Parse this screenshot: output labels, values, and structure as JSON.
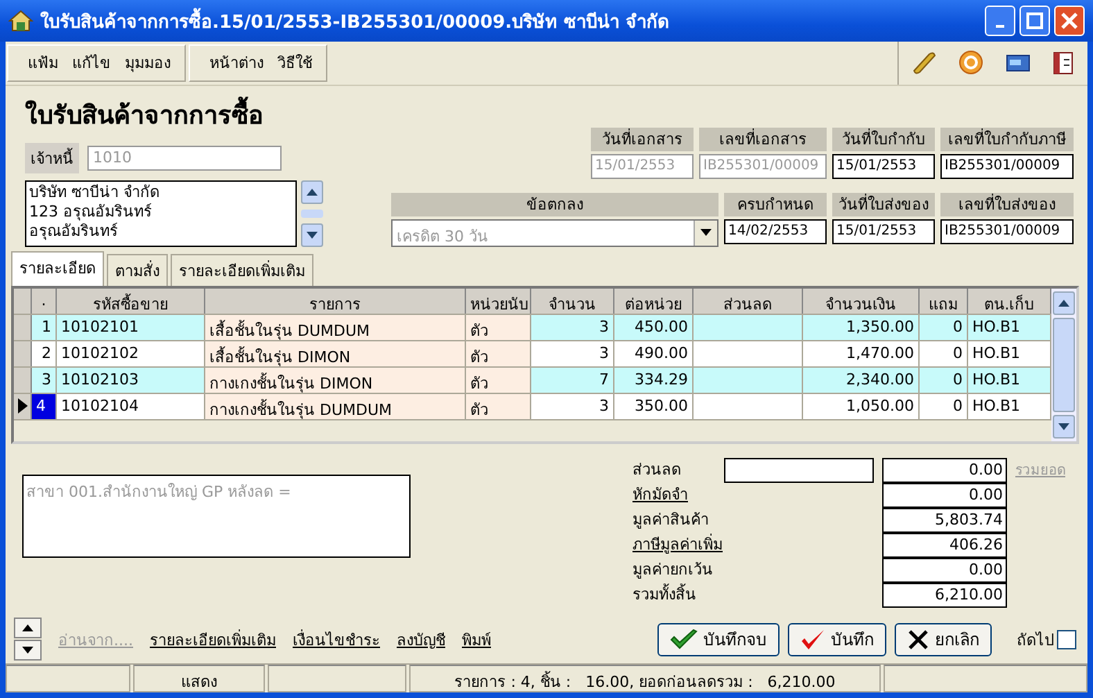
{
  "window": {
    "title": "ใบรับสินค้าจากการซื้อ.15/01/2553-IB255301/00009.บริษัท ซาบีน่า จำกัด"
  },
  "menu": [
    {
      "items": [
        "แฟ้ม",
        "แก้ไข",
        "มุมมอง"
      ]
    },
    {
      "items": [
        "หน้าต่าง",
        "วิธีใช้"
      ]
    }
  ],
  "form": {
    "heading": "ใบรับสินค้าจากการซื้อ",
    "creditor_label": "เจ้าหนี้",
    "creditor_code": "1010",
    "address_lines": [
      "บริษัท ซาบีน่า จำกัด",
      "123 อรุณอัมรินทร์",
      "อรุณอัมรินทร์"
    ],
    "header_fields": [
      {
        "label": "วันที่เอกสาร",
        "value": "15/01/2553",
        "disabled": true
      },
      {
        "label": "เลขที่เอกสาร",
        "value": "IB255301/00009",
        "disabled": true
      },
      {
        "label": "วันที่ใบกำกับ",
        "value": "15/01/2553",
        "disabled": false
      },
      {
        "label": "เลขที่ใบกำกับภาษี",
        "value": "IB255301/00009",
        "disabled": false
      }
    ],
    "terms": {
      "label": "ข้อตกลง",
      "value": "เครดิต 30 วัน"
    },
    "second_fields": [
      {
        "label": "ครบกำหนด",
        "value": "14/02/2553"
      },
      {
        "label": "วันที่ใบส่งของ",
        "value": "15/01/2553"
      },
      {
        "label": "เลขที่ใบส่งของ",
        "value": "IB255301/00009"
      }
    ]
  },
  "tabs": [
    {
      "label": "รายละเอียด",
      "selected": true
    },
    {
      "label": "ตามสั่ง",
      "selected": false
    },
    {
      "label": "รายละเอียดเพิ่มเติม",
      "selected": false
    }
  ],
  "table": {
    "columns": [
      ".",
      "รหัสซื้อขาย",
      "รายการ",
      "หน่วยนับ",
      "จำนวน",
      "ต่อหน่วย",
      "ส่วนลด",
      "จำนวนเงิน",
      "แถม",
      "ตน.เก็บ"
    ],
    "rows": [
      {
        "no": "1",
        "code": "10102101",
        "item": "เสื้อชั้นในรุ่น DUMDUM",
        "unit": "ตัว",
        "qty": "3",
        "price": "450.00",
        "discount": "",
        "amount": "1,350.00",
        "free": "0",
        "location": "HO.B1",
        "selected": false
      },
      {
        "no": "2",
        "code": "10102102",
        "item": "เสื้อชั้นในรุ่น DIMON",
        "unit": "ตัว",
        "qty": "3",
        "price": "490.00",
        "discount": "",
        "amount": "1,470.00",
        "free": "0",
        "location": "HO.B1",
        "selected": false
      },
      {
        "no": "3",
        "code": "10102103",
        "item": "กางเกงชั้นในรุ่น DIMON",
        "unit": "ตัว",
        "qty": "7",
        "price": "334.29",
        "discount": "",
        "amount": "2,340.00",
        "free": "0",
        "location": "HO.B1",
        "selected": false
      },
      {
        "no": "4",
        "code": "10102104",
        "item": "กางเกงชั้นในรุ่น DUMDUM",
        "unit": "ตัว",
        "qty": "3",
        "price": "350.00",
        "discount": "",
        "amount": "1,050.00",
        "free": "0",
        "location": "HO.B1",
        "selected": true
      }
    ]
  },
  "note": "สาขา 001.สำนักงานใหญ่ GP หลังลด =",
  "totals": [
    {
      "label": "ส่วนลด",
      "value": "0.00",
      "kind": "input",
      "link": false
    },
    {
      "label": "หักมัดจำ",
      "value": "0.00",
      "kind": "plain",
      "link": true
    },
    {
      "label": "มูลค่าสินค้า",
      "value": "5,803.74",
      "kind": "plain",
      "link": false
    },
    {
      "label": "ภาษีมูลค่าเพิ่ม",
      "value": "406.26",
      "kind": "plain",
      "link": true
    },
    {
      "label": "มูลค่ายกเว้น",
      "value": "0.00",
      "kind": "plain",
      "link": false
    },
    {
      "label": "รวมทั้งสิ้น",
      "value": "6,210.00",
      "kind": "plain",
      "link": false
    }
  ],
  "sum_link": "รวมยอด",
  "links": [
    {
      "label": "อ่านจาก....",
      "disabled": true
    },
    {
      "label": "รายละเอียดเพิ่มเติม",
      "disabled": false
    },
    {
      "label": "เงื่อนไขชำระ",
      "disabled": false
    },
    {
      "label": "ลงบัญชี",
      "disabled": false
    },
    {
      "label": "พิมพ์",
      "disabled": false
    }
  ],
  "buttons": [
    {
      "label": "บันทึกจบ",
      "kind": "save_close"
    },
    {
      "label": "บันทึก",
      "kind": "save"
    },
    {
      "label": "ยกเลิก",
      "kind": "cancel"
    }
  ],
  "next": {
    "label": "ถัดไป",
    "checked": false
  },
  "status_bar": {
    "mode": "แสดง",
    "summary": "รายการ : 4, ชิ้น :   16.00, ยอดก่อนลดรวม :   6,210.00"
  }
}
